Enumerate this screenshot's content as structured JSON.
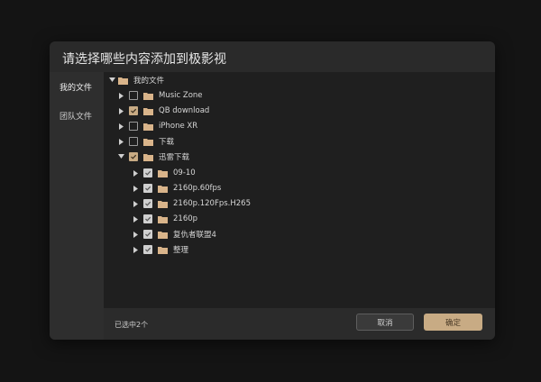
{
  "dialog": {
    "title": "请选择哪些内容添加到极影视"
  },
  "sidebar": {
    "items": [
      {
        "label": "我的文件",
        "active": true
      },
      {
        "label": "团队文件",
        "active": false
      }
    ]
  },
  "tree": {
    "root": {
      "label": "我的文件",
      "expanded": true
    },
    "items": [
      {
        "label": "Music Zone",
        "checked": false
      },
      {
        "label": "QB download",
        "checked": true
      },
      {
        "label": "iPhone XR",
        "checked": false
      },
      {
        "label": "下载",
        "checked": false
      },
      {
        "label": "迅雷下载",
        "checked": true,
        "expanded": true,
        "children": [
          {
            "label": "09-10",
            "checked": true
          },
          {
            "label": "2160p.60fps",
            "checked": true
          },
          {
            "label": "2160p.120Fps.H265",
            "checked": true
          },
          {
            "label": "2160p",
            "checked": true
          },
          {
            "label": "复仇者联盟4",
            "checked": true
          },
          {
            "label": "整理",
            "checked": true
          }
        ]
      }
    ]
  },
  "footer": {
    "status": "已选中2个",
    "cancel_label": "取消",
    "ok_label": "确定"
  },
  "colors": {
    "accent": "#c8ab84",
    "folder": "#d9b48a",
    "background": "#141414",
    "panel": "#1f1f1f"
  }
}
